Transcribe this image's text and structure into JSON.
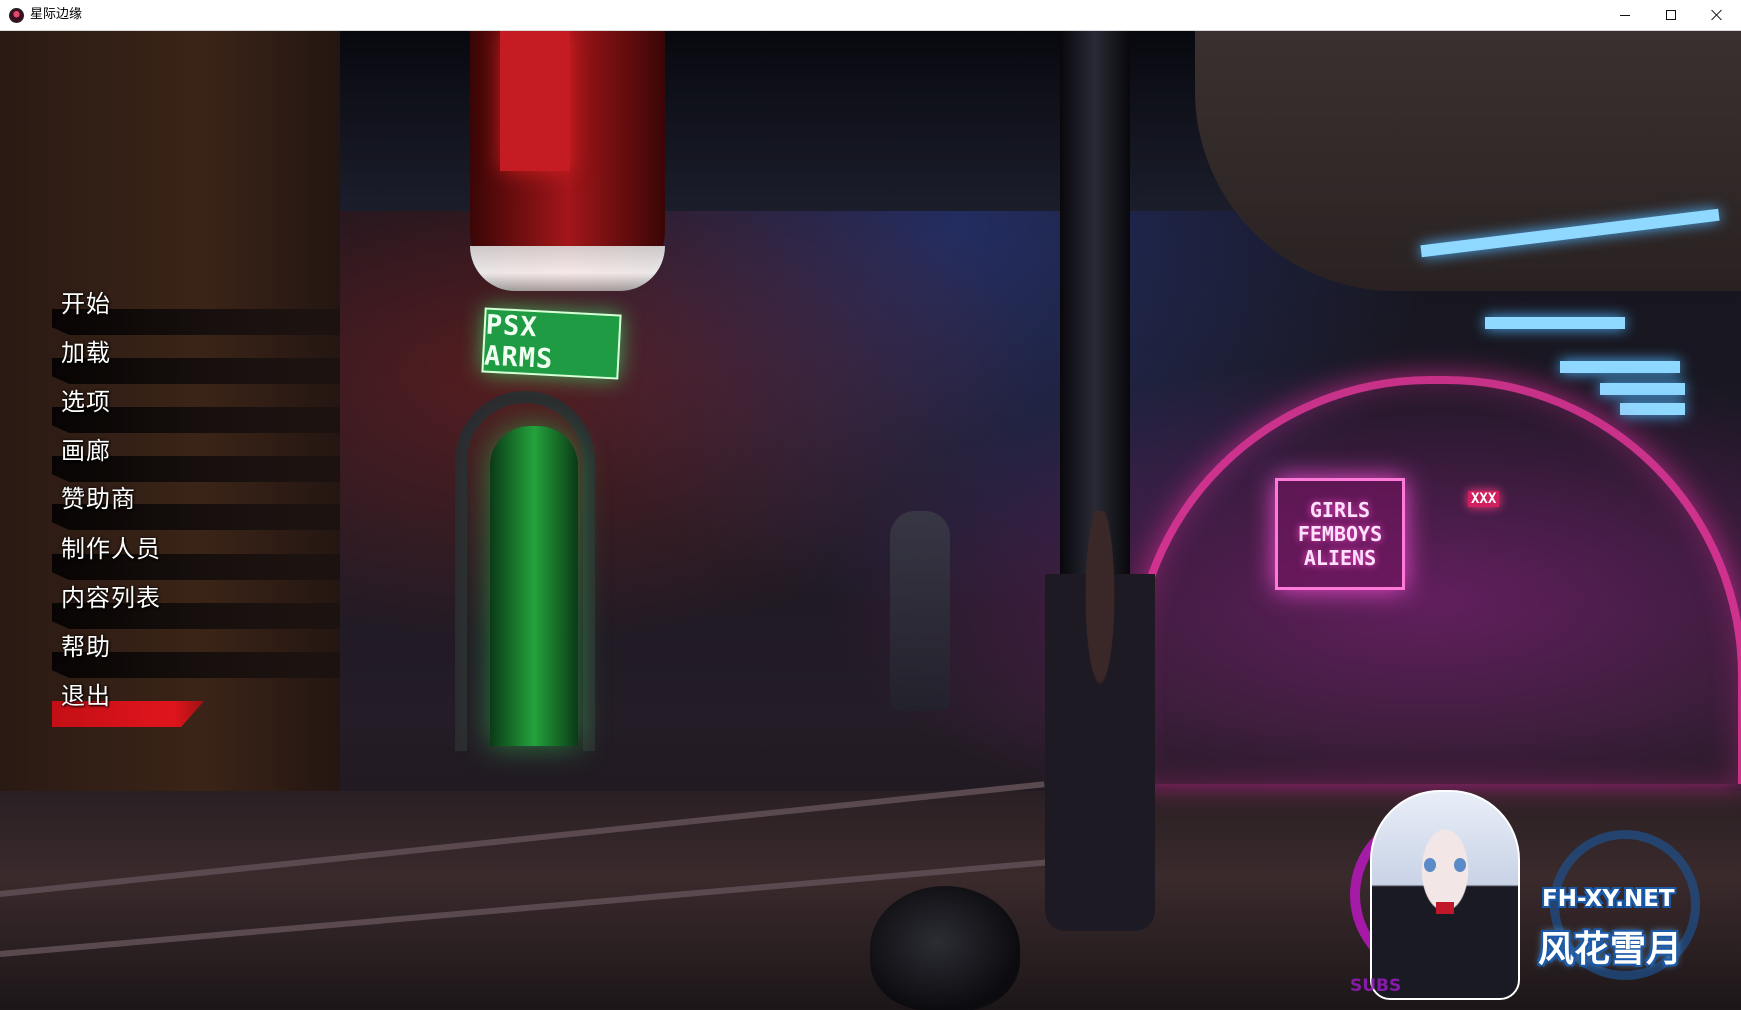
{
  "window": {
    "title": "星际边缘",
    "controls": {
      "minimize": "minimize",
      "maximize": "maximize",
      "close": "close"
    }
  },
  "scene": {
    "signs": {
      "shop": "PSX ARMS",
      "club_line1": "GIRLS",
      "club_line2": "FEMBOYS",
      "club_line3": "ALIENS",
      "xxx": "XXX"
    },
    "accent_colors": {
      "menu_highlight": "#e0151c",
      "neon_pink": "#ff3aa8",
      "neon_green": "#1f9c43",
      "light_blue": "#8fd8ff"
    }
  },
  "main_menu": {
    "items": [
      {
        "label": "开始",
        "active": false
      },
      {
        "label": "加载",
        "active": false
      },
      {
        "label": "选项",
        "active": false
      },
      {
        "label": "画廊",
        "active": false
      },
      {
        "label": "赞助商",
        "active": false
      },
      {
        "label": "制作人员",
        "active": false
      },
      {
        "label": "内容列表",
        "active": false
      },
      {
        "label": "帮助",
        "active": false
      },
      {
        "label": "退出",
        "active": true
      }
    ]
  },
  "watermark": {
    "url": "FH-XY.NET",
    "name": "风花雪月",
    "subtitle": "SUBS"
  }
}
